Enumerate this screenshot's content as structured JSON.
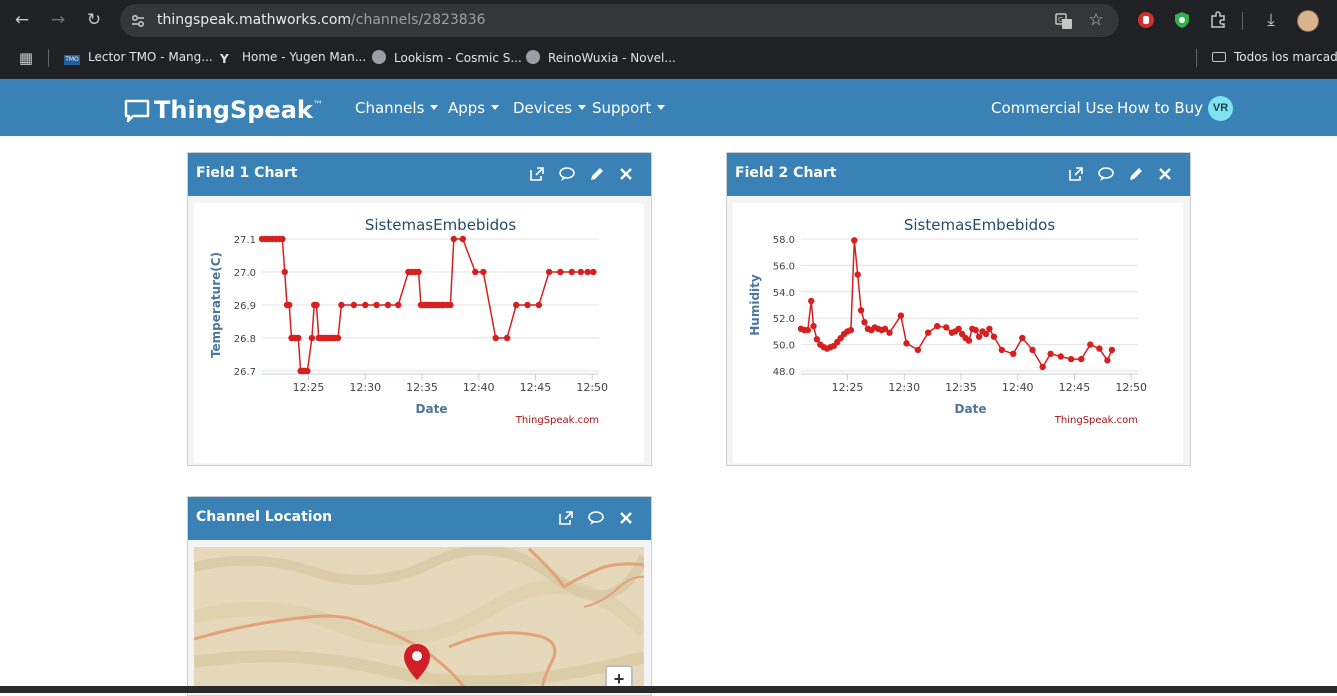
{
  "browser": {
    "url_host": "thingspeak.mathworks.com",
    "url_path": "/channels/2823836",
    "bookmarks": [
      {
        "label": "Lector TMO - Mang..."
      },
      {
        "label": "Home - Yugen Man..."
      },
      {
        "label": "Lookism - Cosmic S..."
      },
      {
        "label": "ReinoWuxia - Novel..."
      }
    ],
    "all_bookmarks": "Todos los marcado"
  },
  "nav": {
    "brand": "ThingSpeak",
    "brand_tm": "™",
    "menu": [
      "Channels",
      "Apps",
      "Devices",
      "Support"
    ],
    "commercial": "Commercial Use",
    "how_to_buy": "How to Buy",
    "avatar": "VR"
  },
  "panels": {
    "field1": {
      "title": "Field 1 Chart"
    },
    "field2": {
      "title": "Field 2 Chart"
    },
    "location": {
      "title": "Channel Location",
      "zoom_in": "+"
    }
  },
  "chart_data": [
    {
      "type": "line",
      "title": "SistemasEmbebidos",
      "xlabel": "Date",
      "ylabel": "Temperature(C)",
      "credit": "ThingSpeak.com",
      "color": "#d62020",
      "xlim": [
        20.9,
        50.6
      ],
      "ylim": [
        26.7,
        27.1
      ],
      "xticks": [
        {
          "v": 25,
          "label": "12:25"
        },
        {
          "v": 30,
          "label": "12:30"
        },
        {
          "v": 35,
          "label": "12:35"
        },
        {
          "v": 40,
          "label": "12:40"
        },
        {
          "v": 45,
          "label": "12:45"
        },
        {
          "v": 50,
          "label": "12:50"
        }
      ],
      "yticks": [
        {
          "v": 26.7,
          "label": "26.7"
        },
        {
          "v": 26.8,
          "label": "26.8"
        },
        {
          "v": 26.9,
          "label": "26.9"
        },
        {
          "v": 27.0,
          "label": "27.0"
        },
        {
          "v": 27.1,
          "label": "27.1"
        }
      ],
      "points": [
        [
          20.9,
          27.1
        ],
        [
          21.2,
          27.1
        ],
        [
          21.5,
          27.1
        ],
        [
          21.8,
          27.1
        ],
        [
          22.1,
          27.1
        ],
        [
          22.4,
          27.1
        ],
        [
          22.7,
          27.1
        ],
        [
          22.9,
          27.0
        ],
        [
          23.1,
          26.9
        ],
        [
          23.3,
          26.9
        ],
        [
          23.5,
          26.8
        ],
        [
          23.7,
          26.8
        ],
        [
          23.9,
          26.8
        ],
        [
          24.1,
          26.8
        ],
        [
          24.3,
          26.7
        ],
        [
          24.5,
          26.7
        ],
        [
          24.7,
          26.7
        ],
        [
          24.9,
          26.7
        ],
        [
          25.3,
          26.8
        ],
        [
          25.5,
          26.9
        ],
        [
          25.7,
          26.9
        ],
        [
          25.9,
          26.8
        ],
        [
          26.1,
          26.8
        ],
        [
          26.3,
          26.8
        ],
        [
          26.5,
          26.8
        ],
        [
          26.7,
          26.8
        ],
        [
          26.9,
          26.8
        ],
        [
          27.1,
          26.8
        ],
        [
          27.3,
          26.8
        ],
        [
          27.6,
          26.8
        ],
        [
          27.9,
          26.9
        ],
        [
          29.0,
          26.9
        ],
        [
          30.0,
          26.9
        ],
        [
          31.0,
          26.9
        ],
        [
          32.0,
          26.9
        ],
        [
          32.9,
          26.9
        ],
        [
          33.8,
          27.0
        ],
        [
          34.1,
          27.0
        ],
        [
          34.4,
          27.0
        ],
        [
          34.7,
          27.0
        ],
        [
          34.9,
          26.9
        ],
        [
          35.1,
          26.9
        ],
        [
          35.3,
          26.9
        ],
        [
          35.5,
          26.9
        ],
        [
          35.7,
          26.9
        ],
        [
          35.9,
          26.9
        ],
        [
          36.1,
          26.9
        ],
        [
          36.3,
          26.9
        ],
        [
          36.5,
          26.9
        ],
        [
          36.7,
          26.9
        ],
        [
          36.9,
          26.9
        ],
        [
          37.2,
          26.9
        ],
        [
          37.5,
          26.9
        ],
        [
          37.8,
          27.1
        ],
        [
          38.6,
          27.1
        ],
        [
          39.7,
          27.0
        ],
        [
          40.4,
          27.0
        ],
        [
          41.5,
          26.8
        ],
        [
          42.5,
          26.8
        ],
        [
          43.3,
          26.9
        ],
        [
          44.3,
          26.9
        ],
        [
          45.3,
          26.9
        ],
        [
          46.2,
          27.0
        ],
        [
          47.2,
          27.0
        ],
        [
          48.2,
          27.0
        ],
        [
          49.0,
          27.0
        ],
        [
          49.6,
          27.0
        ],
        [
          50.1,
          27.0
        ]
      ]
    },
    {
      "type": "line",
      "title": "SistemasEmbebidos",
      "xlabel": "Date",
      "ylabel": "Humidity",
      "credit": "ThingSpeak.com",
      "color": "#d62020",
      "xlim": [
        20.9,
        50.6
      ],
      "ylim": [
        48.0,
        58.0
      ],
      "xticks": [
        {
          "v": 25,
          "label": "12:25"
        },
        {
          "v": 30,
          "label": "12:30"
        },
        {
          "v": 35,
          "label": "12:35"
        },
        {
          "v": 40,
          "label": "12:40"
        },
        {
          "v": 45,
          "label": "12:45"
        },
        {
          "v": 50,
          "label": "12:50"
        }
      ],
      "yticks": [
        {
          "v": 48,
          "label": "48.0"
        },
        {
          "v": 50,
          "label": "50.0"
        },
        {
          "v": 52,
          "label": "52.0"
        },
        {
          "v": 54,
          "label": "54.0"
        },
        {
          "v": 56,
          "label": "56.0"
        },
        {
          "v": 58,
          "label": "58.0"
        }
      ],
      "points": [
        [
          20.9,
          51.2
        ],
        [
          21.2,
          51.1
        ],
        [
          21.5,
          51.1
        ],
        [
          21.8,
          53.3
        ],
        [
          22.0,
          51.4
        ],
        [
          22.3,
          50.4
        ],
        [
          22.6,
          50.0
        ],
        [
          22.9,
          49.8
        ],
        [
          23.2,
          49.7
        ],
        [
          23.5,
          49.8
        ],
        [
          23.8,
          49.9
        ],
        [
          24.1,
          50.2
        ],
        [
          24.4,
          50.5
        ],
        [
          24.7,
          50.8
        ],
        [
          25.0,
          51.0
        ],
        [
          25.3,
          51.1
        ],
        [
          25.6,
          57.9
        ],
        [
          25.9,
          55.3
        ],
        [
          26.2,
          52.6
        ],
        [
          26.5,
          51.7
        ],
        [
          26.8,
          51.2
        ],
        [
          27.1,
          51.1
        ],
        [
          27.4,
          51.3
        ],
        [
          27.7,
          51.2
        ],
        [
          28.0,
          51.1
        ],
        [
          28.3,
          51.2
        ],
        [
          28.7,
          50.9
        ],
        [
          29.7,
          52.2
        ],
        [
          30.2,
          50.1
        ],
        [
          31.2,
          49.6
        ],
        [
          32.1,
          50.9
        ],
        [
          32.9,
          51.4
        ],
        [
          33.7,
          51.3
        ],
        [
          34.2,
          50.9
        ],
        [
          34.5,
          51.0
        ],
        [
          34.8,
          51.2
        ],
        [
          35.1,
          50.8
        ],
        [
          35.4,
          50.5
        ],
        [
          35.7,
          50.3
        ],
        [
          36.0,
          51.2
        ],
        [
          36.3,
          51.1
        ],
        [
          36.6,
          50.6
        ],
        [
          36.9,
          51.0
        ],
        [
          37.2,
          50.8
        ],
        [
          37.5,
          51.2
        ],
        [
          37.9,
          50.6
        ],
        [
          38.6,
          49.6
        ],
        [
          39.6,
          49.3
        ],
        [
          40.4,
          50.5
        ],
        [
          41.3,
          49.6
        ],
        [
          42.2,
          48.3
        ],
        [
          42.9,
          49.3
        ],
        [
          43.8,
          49.1
        ],
        [
          44.7,
          48.9
        ],
        [
          45.6,
          48.9
        ],
        [
          46.4,
          50.0
        ],
        [
          47.2,
          49.7
        ],
        [
          47.9,
          48.8
        ],
        [
          48.3,
          49.6
        ]
      ]
    }
  ]
}
